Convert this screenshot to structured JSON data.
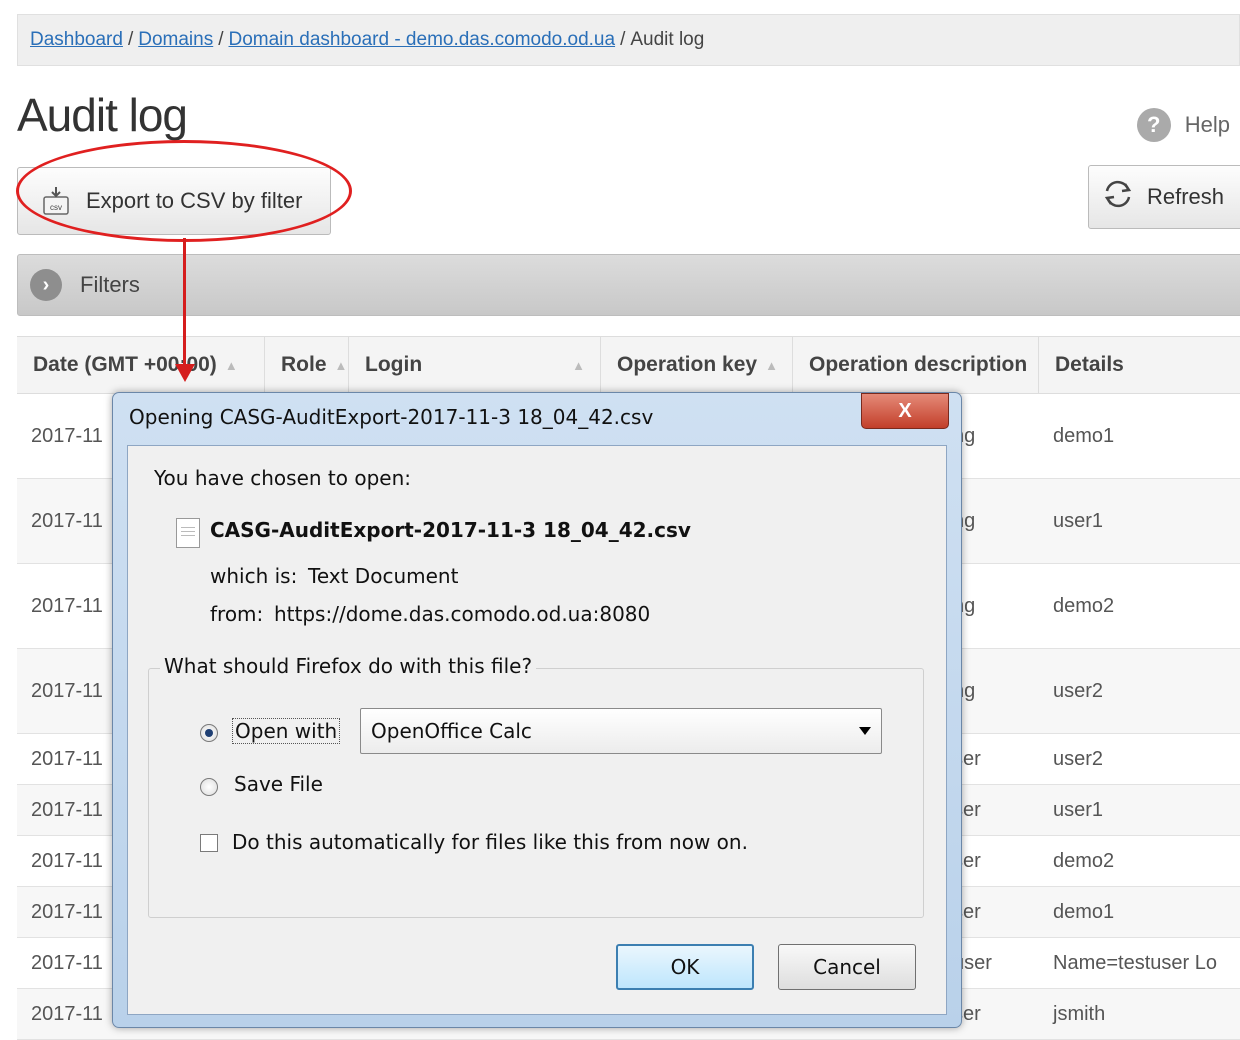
{
  "breadcrumb": {
    "items": [
      "Dashboard",
      "Domains",
      "Domain dashboard - demo.das.comodo.od.ua"
    ],
    "current": "Audit log",
    "separator": "/"
  },
  "page": {
    "title": "Audit log",
    "help_label": "Help"
  },
  "toolbar": {
    "export_label": "Export to CSV by filter",
    "refresh_label": "Refresh"
  },
  "filters": {
    "label": "Filters"
  },
  "table": {
    "headers": {
      "date": "Date (GMT +00:00)",
      "role": "Role",
      "login": "Login",
      "operation_key": "Operation key",
      "operation_description": "Operation description",
      "details": "Details"
    },
    "rows": [
      {
        "date": "2017-11",
        "op": "ng",
        "details": "demo1"
      },
      {
        "date": "2017-11",
        "op": "ng",
        "details": "user1"
      },
      {
        "date": "2017-11",
        "op": "ng",
        "details": "demo2"
      },
      {
        "date": "2017-11",
        "op": "ng",
        "details": "user2"
      },
      {
        "date": "2017-11",
        "op": "ser",
        "details": "user2"
      },
      {
        "date": "2017-11",
        "op": "ser",
        "details": "user1"
      },
      {
        "date": "2017-11",
        "op": "ser",
        "details": "demo2"
      },
      {
        "date": "2017-11",
        "op": "ser",
        "details": "demo1"
      },
      {
        "date": "2017-11",
        "op": "user",
        "details": "Name=testuser Lo"
      },
      {
        "date": "2017-11",
        "op": "ser",
        "details": "jsmith"
      }
    ]
  },
  "dialog": {
    "title": "Opening CASG-AuditExport-2017-11-3 18_04_42.csv",
    "close_label": "X",
    "chosen_label": "You have chosen to open:",
    "filename": "CASG-AuditExport-2017-11-3 18_04_42.csv",
    "which_is_label": "which is:",
    "which_is_value": "Text Document",
    "from_label": "from:",
    "from_value": "https://dome.das.comodo.od.ua:8080",
    "question": "What should Firefox do with this file?",
    "open_with_label": "Open with",
    "open_with_value": "OpenOffice Calc",
    "save_file_label": "Save File",
    "auto_label": "Do this automatically for files like this from now on.",
    "ok_label": "OK",
    "cancel_label": "Cancel"
  },
  "annotation": {
    "color": "#e02020"
  }
}
